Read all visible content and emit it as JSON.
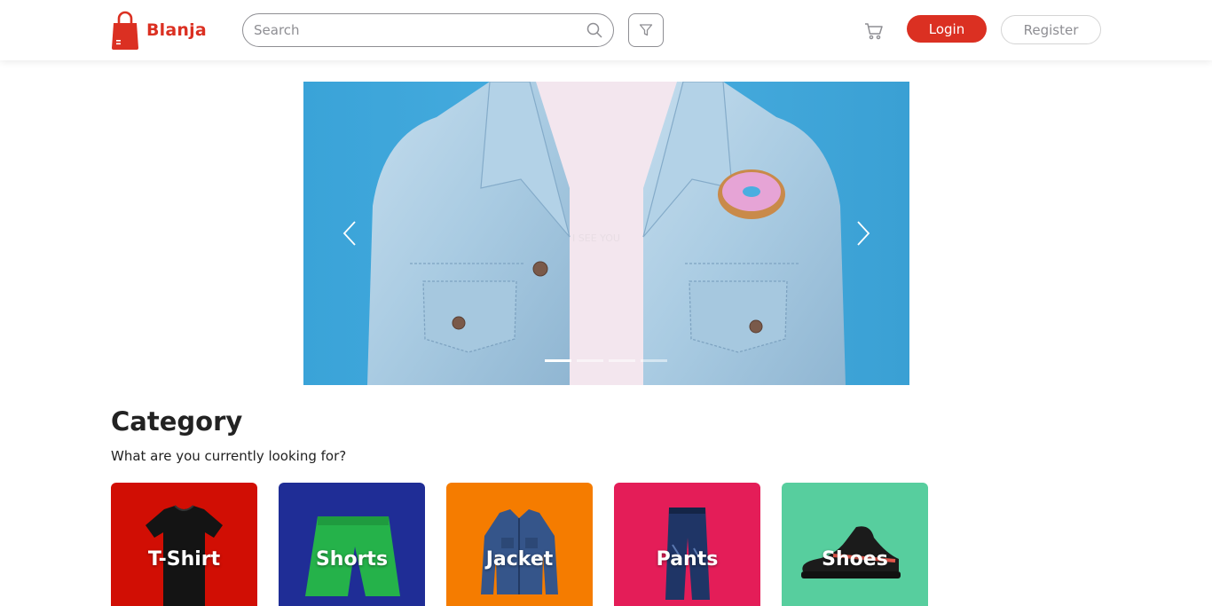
{
  "brand": {
    "name": "Blanja",
    "color": "#db3022"
  },
  "search": {
    "placeholder": "Search",
    "value": ""
  },
  "icons": {
    "search": "search-icon",
    "filter": "filter-icon",
    "cart": "cart-icon",
    "prev": "chevron-left-icon",
    "next": "chevron-right-icon"
  },
  "auth": {
    "login_label": "Login",
    "register_label": "Register"
  },
  "carousel": {
    "slide_count": 4,
    "active_slide": 1,
    "shirt_text": "I SEE YOU"
  },
  "category": {
    "title": "Category",
    "subtitle": "What are you currently looking for?",
    "items": [
      {
        "label": "T-Shirt",
        "color": "#d10e04"
      },
      {
        "label": "Shorts",
        "color": "#1f2d96"
      },
      {
        "label": "Jacket",
        "color": "#f57c00"
      },
      {
        "label": "Pants",
        "color": "#e41d58"
      },
      {
        "label": "Shoes",
        "color": "#57ce9e"
      }
    ]
  }
}
